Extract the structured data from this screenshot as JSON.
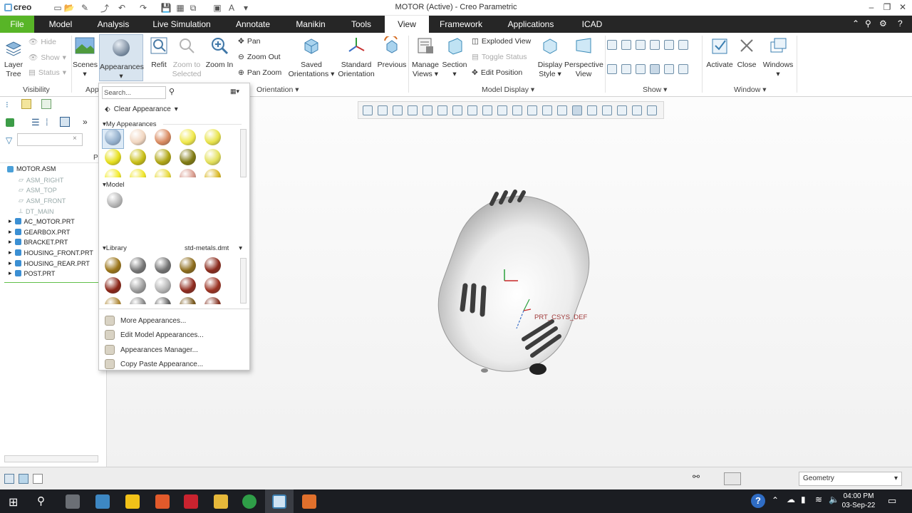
{
  "titlebar": {
    "logo": "creo",
    "window_title": "MOTOR (Active) - Creo Parametric",
    "controls": [
      "–",
      "❐",
      "✕"
    ]
  },
  "menu": {
    "tabs": [
      "File",
      "Model",
      "Analysis",
      "Live Simulation",
      "Annotate",
      "Manikin",
      "Tools",
      "View",
      "Framework",
      "Applications",
      "ICAD"
    ],
    "active": "View"
  },
  "ribbon": {
    "visibility": {
      "layer_tree_1": "Layer",
      "layer_tree_2": "Tree",
      "hide": "Hide",
      "show": "Show",
      "status": "Status",
      "group": "Visibility"
    },
    "appearance": {
      "scenes": "Scenes",
      "appearances": "Appearances",
      "group": "Appearance"
    },
    "orientation": {
      "refit": "Refit",
      "zoom_to_selected_1": "Zoom to",
      "zoom_to_selected_2": "Selected",
      "zoom_in": "Zoom In",
      "pan": "Pan",
      "zoom_out": "Zoom Out",
      "pan_zoom": "Pan Zoom",
      "saved_1": "Saved",
      "saved_2": "Orientations",
      "standard_1": "Standard",
      "standard_2": "Orientation",
      "previous": "Previous",
      "group": "Orientation"
    },
    "model_display": {
      "manage_1": "Manage",
      "manage_2": "Views",
      "section": "Section",
      "exploded": "Exploded View",
      "toggle": "Toggle Status",
      "edit_position": "Edit Position",
      "display_1": "Display",
      "display_2": "Style",
      "persp_1": "Perspective",
      "persp_2": "View",
      "group": "Model Display"
    },
    "show": {
      "group": "Show"
    },
    "window": {
      "activate": "Activate",
      "close": "Close",
      "windows": "Windows",
      "group": "Window"
    }
  },
  "appearance_panel": {
    "search_placeholder": "Search...",
    "clear": "Clear Appearance",
    "my_appearances": "My Appearances",
    "model": "Model",
    "library": "Library",
    "library_file": "std-metals.dmt",
    "my_swatches": [
      "#9fb2c8",
      "#f1d6c0",
      "#d98a60",
      "#f0e84a",
      "#e8e34a",
      "#e6df1c",
      "#c9bf16",
      "#b0a614",
      "#817b12",
      "#e3e05a",
      "#f2ea2a",
      "#efe52a",
      "#e7d93c",
      "#d89a8c",
      "#d9b826"
    ],
    "library_swatches": [
      "#9a7418",
      "#767676",
      "#727272",
      "#8d6c1c",
      "#8a2a1c",
      "#8a2416",
      "#9c9c9c",
      "#b4b4b4",
      "#8f2a1e",
      "#9a3222",
      "#b08a3a",
      "#8a8a8a",
      "#666",
      "#7a5a20",
      "#883828"
    ],
    "menu": [
      "More Appearances...",
      "Edit Model Appearances...",
      "Appearances Manager...",
      "Copy Paste Appearance..."
    ]
  },
  "tree": {
    "root": "MOTOR.ASM",
    "datums": [
      "ASM_RIGHT",
      "ASM_TOP",
      "ASM_FRONT",
      "DT_MAIN"
    ],
    "parts": [
      "AC_MOTOR.PRT",
      "GEARBOX.PRT",
      "BRACKET.PRT",
      "HOUSING_FRONT.PRT",
      "HOUSING_REAR.PRT",
      "POST.PRT"
    ],
    "col_label": "P"
  },
  "viewport": {
    "csys_label": "PRT_CSYS_DEF"
  },
  "statusbar": {
    "filter": "Geometry"
  },
  "taskbar": {
    "time": "04:00 PM",
    "date": "03-Sep-22"
  }
}
